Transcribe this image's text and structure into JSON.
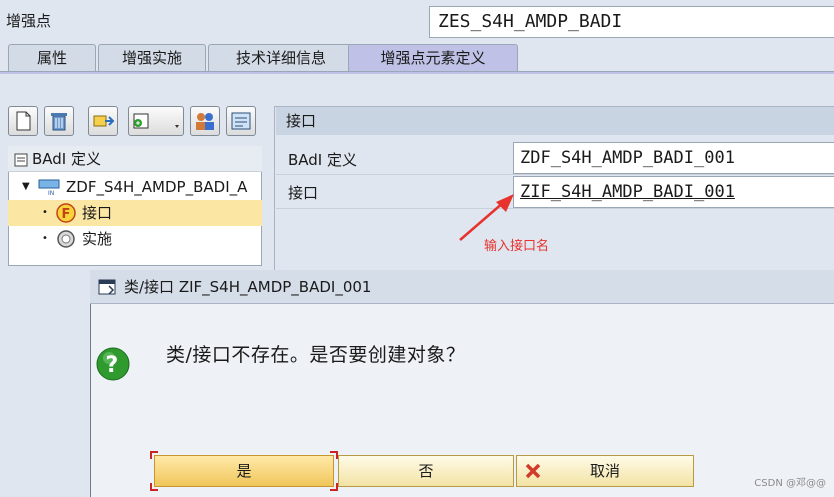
{
  "header": {
    "label": "增强点",
    "value": "ZES_S4H_AMDP_BADI"
  },
  "tabs": [
    {
      "label": "属性"
    },
    {
      "label": "增强实施"
    },
    {
      "label": "技术详细信息"
    },
    {
      "label": "增强点元素定义"
    }
  ],
  "toolbar": {
    "icons": [
      "create-icon",
      "delete-icon",
      "move-icon",
      "add-dropdown-icon",
      "users-icon",
      "display-icon"
    ]
  },
  "tree": {
    "header": "BAdI 定义",
    "root": "ZDF_S4H_AMDP_BADI_A",
    "children": [
      {
        "label": "接口"
      },
      {
        "label": "实施"
      }
    ]
  },
  "detail": {
    "title": "接口",
    "rows": [
      {
        "label": "BAdI 定义",
        "value": "ZDF_S4H_AMDP_BADI_001"
      },
      {
        "label": "接口",
        "value": "ZIF_S4H_AMDP_BADI_001"
      }
    ]
  },
  "annotation": "输入接口名",
  "dialog": {
    "title": "类/接口 ZIF_S4H_AMDP_BADI_001",
    "message": "类/接口不存在。是否要创建对象？",
    "buttons": {
      "yes": "是",
      "no": "否",
      "cancel": "取消"
    }
  },
  "watermark": "CSDN @邓@@",
  "colors": {
    "accent_tab": "#bfc2e6",
    "selection": "#fbe6a4",
    "annotation": "#e8322e",
    "button": "#f2e3a4"
  }
}
